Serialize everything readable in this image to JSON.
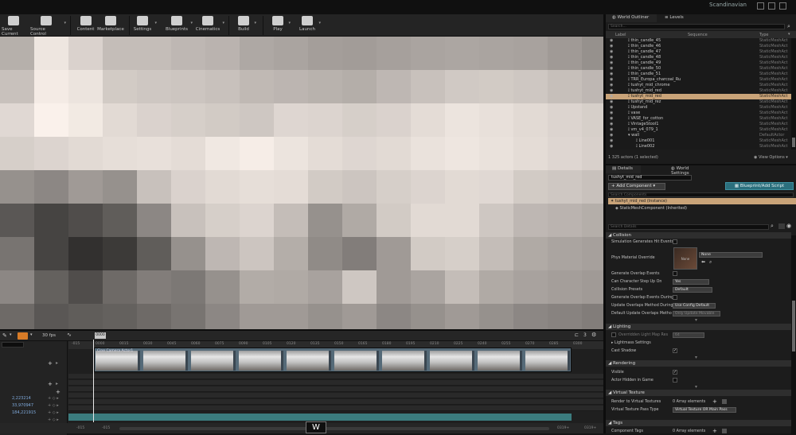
{
  "titlebar": {
    "user": "Scandinavian"
  },
  "toolbar": {
    "buttons": [
      {
        "label": "Save Current",
        "icon": "save-icon"
      },
      {
        "label": "Source Control",
        "icon": "source-control-icon"
      },
      {
        "label": "Content",
        "icon": "content-icon"
      },
      {
        "label": "Marketplace",
        "icon": "marketplace-icon"
      },
      {
        "label": "Settings",
        "icon": "gear-icon"
      },
      {
        "label": "Blueprints",
        "icon": "blueprint-icon"
      },
      {
        "label": "Cinematics",
        "icon": "clapper-icon"
      },
      {
        "label": "Build",
        "icon": "build-icon"
      },
      {
        "label": "Play",
        "icon": "play-icon"
      },
      {
        "label": "Launch",
        "icon": "launch-icon"
      }
    ]
  },
  "sequencer": {
    "fps": "30 fps",
    "frame": "0000",
    "ruler_ticks": [
      "-015",
      "0000",
      "0015",
      "0030",
      "0045",
      "0060",
      "0075",
      "0090",
      "0105",
      "0120",
      "0135",
      "0150",
      "0165",
      "0180",
      "0195",
      "0210",
      "0225",
      "0240",
      "0255",
      "0270",
      "0285",
      "0300"
    ],
    "shot_label": "Cine Camera Actor1",
    "values": [
      "2,223214",
      "33,970947",
      "184,221915"
    ],
    "bottom_start": "-015",
    "bottom_start2": "-015",
    "bottom_end": "0319+",
    "bottom_end2": "0319+",
    "key_hint": "W",
    "marker_count": "3"
  },
  "outliner": {
    "tabs": [
      "World Outliner",
      "Levels"
    ],
    "search_placeholder": "Search...",
    "columns": [
      "Label",
      "Sequence",
      "Type"
    ],
    "rows": [
      {
        "name": "thin_candle_45",
        "type": "StaticMeshAct"
      },
      {
        "name": "thin_candle_46",
        "type": "StaticMeshAct"
      },
      {
        "name": "thin_candle_47",
        "type": "StaticMeshAct"
      },
      {
        "name": "thin_candle_48",
        "type": "StaticMeshAct"
      },
      {
        "name": "thin_candle_49",
        "type": "StaticMeshAct"
      },
      {
        "name": "thin_candle_50",
        "type": "StaticMeshAct"
      },
      {
        "name": "thin_candle_51",
        "type": "StaticMeshAct"
      },
      {
        "name": "TRR_Europa_charcoal_Ru",
        "type": "StaticMeshAct"
      },
      {
        "name": "tushyt_mid_chrome",
        "type": "StaticMeshAct"
      },
      {
        "name": "tushyt_mid_red",
        "type": "StaticMeshAct"
      },
      {
        "name": "tushyt_mid_red",
        "type": "StaticMeshAct",
        "selected": true
      },
      {
        "name": "tushyt_mid_rez",
        "type": "StaticMeshAct"
      },
      {
        "name": "Upstand",
        "type": "StaticMeshAct"
      },
      {
        "name": "vase",
        "type": "StaticMeshAct"
      },
      {
        "name": "VASE_for_cotton",
        "type": "StaticMeshAct"
      },
      {
        "name": "VintageStool1",
        "type": "StaticMeshAct"
      },
      {
        "name": "vm_v4_079_1",
        "type": "StaticMeshAct"
      },
      {
        "name": "wall",
        "type": "DefaultActor"
      },
      {
        "name": "Line001",
        "type": "StaticMeshAct"
      },
      {
        "name": "Line002",
        "type": "StaticMeshAct"
      }
    ],
    "footer_count": "1 325 actors (1 selected)",
    "view_options": "View Options"
  },
  "details": {
    "tabs": [
      "Details",
      "World Settings"
    ],
    "actor_name": "tushyt_mid_red",
    "add_component": "+ Add Component",
    "blueprint_button": "Blueprint/Add Script",
    "comp_search": "Search Components",
    "instance_label": "tushyt_mid_red (Instance)",
    "static_mesh_comp": "StaticMeshComponent (Inherited)",
    "details_search": "Search Details",
    "sections": {
      "collision": "Collision",
      "lighting": "Lighting",
      "rendering": "Rendering",
      "virtual_texture": "Virtual Texture",
      "tags": "Tags"
    },
    "props": {
      "sim_hit": "Simulation Generates Hit Events",
      "phys_mat": "Phys Material Override",
      "phys_mat_val": "None",
      "phys_thumb": "None",
      "gen_overlap": "Generate Overlap Events",
      "step_up": "Can Character Step Up On",
      "step_up_val": "Yes",
      "presets": "Collision Presets",
      "presets_val": "Default",
      "overlap_streaming": "Generate Overlap Events During",
      "update_overlap": "Update Overlaps Method During",
      "update_overlap_val": "Use Config Default",
      "default_update": "Default Update Overlaps Metho",
      "default_update_val": "Only Update Movable",
      "lightmap_override": "Overridden Light Map Res",
      "lightmap_val": "64",
      "lightmass": "Lightmass Settings",
      "cast_shadow": "Cast Shadow",
      "visible": "Visible",
      "hidden_game": "Actor Hidden in Game",
      "render_vt": "Render to Virtual Textures",
      "render_vt_val": "0 Array elements",
      "vt_pass": "Virtual Texture Pass Type",
      "vt_pass_val": "Virtual Texture OR Main Pass",
      "comp_tags": "Component Tags",
      "comp_tags_val": "0 Array elements"
    }
  },
  "colors": {
    "selection": "#c9a378",
    "accent_teal": "#2b6f7d",
    "sequencer_track": "#3b7c7e"
  }
}
